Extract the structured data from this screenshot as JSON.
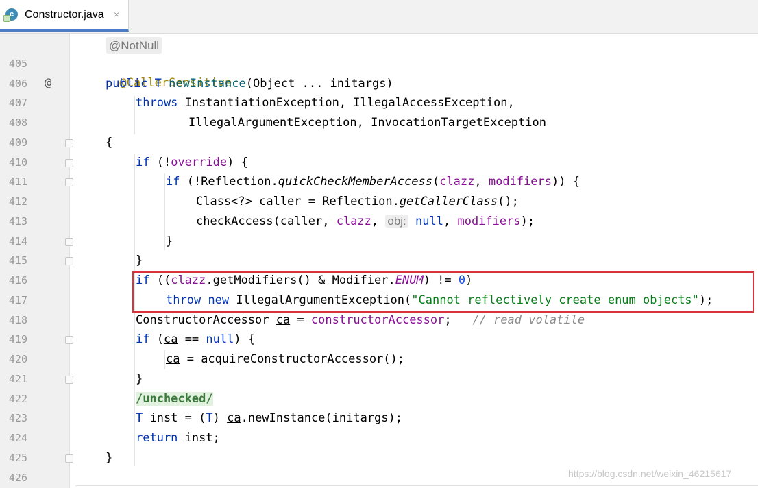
{
  "tab": {
    "label": "Constructor.java",
    "icon": "java-class-icon",
    "close": "×"
  },
  "hint_top": "@NotNull",
  "lines": [
    {
      "n": "405"
    },
    {
      "n": "406"
    },
    {
      "n": "407"
    },
    {
      "n": "408"
    },
    {
      "n": "409"
    },
    {
      "n": "410"
    },
    {
      "n": "411"
    },
    {
      "n": "412"
    },
    {
      "n": "413"
    },
    {
      "n": "414"
    },
    {
      "n": "415"
    },
    {
      "n": "416"
    },
    {
      "n": "417"
    },
    {
      "n": "418"
    },
    {
      "n": "419"
    },
    {
      "n": "420"
    },
    {
      "n": "421"
    },
    {
      "n": "422"
    },
    {
      "n": "423"
    },
    {
      "n": "424"
    },
    {
      "n": "425"
    },
    {
      "n": "426"
    }
  ],
  "code": {
    "l405": {
      "a": "@CallerSensitive"
    },
    "l406": {
      "a": "public",
      "b": " T ",
      "c": "newInstance",
      "d": "(Object ... initargs)"
    },
    "l407": {
      "a": "throws",
      "b": " InstantiationException, IllegalAccessException,"
    },
    "l408": {
      "a": "IllegalArgumentException, InvocationTargetException"
    },
    "l409": {
      "a": "{"
    },
    "l410": {
      "a": "if",
      "b": " (!",
      "c": "override",
      "d": ") {"
    },
    "l411": {
      "a": "if",
      "b": " (!Reflection.",
      "c": "quickCheckMemberAccess",
      "d": "(",
      "e": "clazz",
      "f": ", ",
      "g": "modifiers",
      "h": ")) {"
    },
    "l412": {
      "a": "Class<?> caller = Reflection.",
      "b": "getCallerClass",
      "c": "();"
    },
    "l413": {
      "a": "checkAccess(caller, ",
      "b": "clazz",
      "c": ", ",
      "d": "obj:",
      "e": " null",
      "f": ", ",
      "g": "modifiers",
      "h": ");"
    },
    "l414": {
      "a": "}"
    },
    "l415": {
      "a": "}"
    },
    "l416": {
      "a": "if",
      "b": " ((",
      "c": "clazz",
      "d": ".getModifiers() & Modifier.",
      "e": "ENUM",
      "f": ") != ",
      "g": "0",
      "h": ")"
    },
    "l417": {
      "a": "throw",
      "b": " ",
      "c": "new",
      "d": " IllegalArgumentException(",
      "e": "\"Cannot reflectively create enum objects\"",
      "f": ");"
    },
    "l418": {
      "a": "ConstructorAccessor ",
      "b": "ca",
      "c": " = ",
      "d": "constructorAccessor",
      "e": ";   ",
      "f": "// read volatile"
    },
    "l419": {
      "a": "if",
      "b": " (",
      "c": "ca",
      "d": " == ",
      "e": "null",
      "f": ") {"
    },
    "l420": {
      "a": "ca",
      "b": " = acquireConstructorAccessor();"
    },
    "l421": {
      "a": "}"
    },
    "l422": {
      "a": "/unchecked/"
    },
    "l423": {
      "a": "T",
      "b": " inst = (",
      "c": "T",
      "d": ") ",
      "e": "ca",
      "f": ".newInstance(initargs);"
    },
    "l424": {
      "a": "return",
      "b": " inst;"
    },
    "l425": {
      "a": "}"
    }
  },
  "gutter_marker": "@",
  "watermark": "https://blog.csdn.net/weixin_46215617"
}
